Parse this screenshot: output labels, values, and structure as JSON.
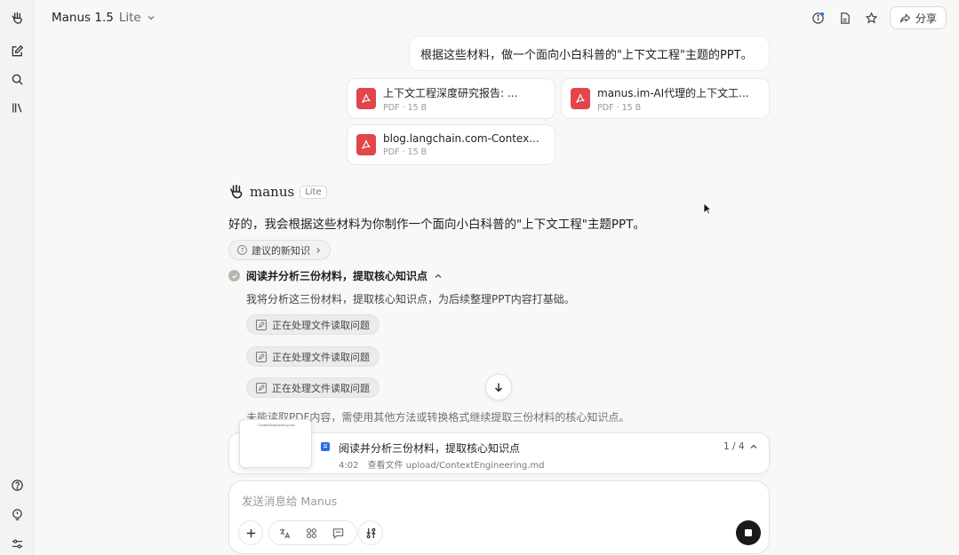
{
  "sidebar": {
    "items": [
      "logo",
      "new-task",
      "search",
      "library",
      "help",
      "idea",
      "settings"
    ]
  },
  "header": {
    "title": "Manus 1.5",
    "version": "Lite",
    "share_label": "分享"
  },
  "user_message": {
    "text": "根据这些材料，做一个面向小白科普的\"上下文工程\"主题的PPT。"
  },
  "attachments": [
    {
      "name": "上下文工程深度研究报告: ...",
      "meta": "PDF · 15 B"
    },
    {
      "name": "manus.im-AI代理的上下文工...",
      "meta": "PDF · 15 B"
    },
    {
      "name": "blog.langchain.com-Contex...",
      "meta": "PDF · 15 B"
    }
  ],
  "assistant": {
    "name": "manus",
    "badge": "Lite",
    "reply": "好的，我会根据这些材料为你制作一个面向小白科普的\"上下文工程\"主题PPT。",
    "suggest_label": "建议的新知识"
  },
  "step": {
    "title": "阅读并分析三份材料，提取核心知识点",
    "description": "我将分析这三份材料，提取核心知识点，为后续整理PPT内容打基础。",
    "tools": [
      "正在处理文件读取问题",
      "正在处理文件读取问题",
      "正在处理文件读取问题"
    ],
    "followup": "未能读取PDF内容，需使用其他方法或转换格式继续提取三份材料的核心知识点。"
  },
  "progress": {
    "thumb_text": "ContextEngineering.md",
    "title": "阅读并分析三份材料，提取核心知识点",
    "time": "4:02",
    "action": "查看文件 upload/ContextEngineering.md",
    "count": "1 / 4"
  },
  "composer": {
    "placeholder": "发送消息给 Manus"
  },
  "colors": {
    "pdf": "#e1464b",
    "accent": "#2b6fe6",
    "background": "#f8f8f7"
  }
}
